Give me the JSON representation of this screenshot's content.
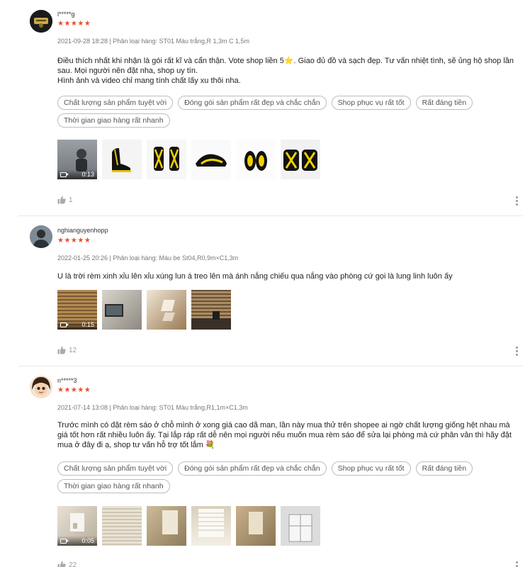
{
  "reviews": [
    {
      "username": "l*****g",
      "rating": 5,
      "stars": "★★★★★",
      "meta": "2021-09-28 18:28 | Phân loại hàng: ST01 Màu trắng,R 1,3m C 1,5m",
      "content": "Điều thích nhất khi nhận là gói rất kĩ và cẩn thận. Vote shop liền 5⭐. Giao đủ đồ và sạch đẹp. Tư vấn nhiệt tình, sẽ ủng hộ shop lần sau. Mọi người nên đặt nha, shop uy tín.\nHình ảnh và video chỉ mang tính chất lấy xu thôi nha.",
      "tags": [
        "Chất lượng sản phẩm tuyệt vời",
        "Đóng gói sản phẩm rất đẹp và chắc chắn",
        "Shop phục vụ rất tốt",
        "Rất đáng tiền",
        "Thời gian giao hàng rất nhanh"
      ],
      "video_duration": "0:13",
      "likes": "1"
    },
    {
      "username": "nghianguyenhopp",
      "rating": 5,
      "stars": "★★★★★",
      "meta": "2022-01-25 20:26 | Phân loại hàng: Màu be St04,R0,9m×C1,3m",
      "content": "U là trời rèm xinh xỉu lên xỉu xúng lun á treo lên mà ánh nắng chiếu qua nắng vào phòng cứ gọi là lung linh luôn ấy",
      "tags": [],
      "video_duration": "0:15",
      "likes": "12"
    },
    {
      "username": "n*****3",
      "rating": 5,
      "stars": "★★★★★",
      "meta": "2021-07-14 13:08 | Phân loại hàng: ST01 Màu trắng,R1,1m×C1,3m",
      "content": "Trước mình có đặt rèm sáo ở chỗ mình ở xong giá cao dã man, lần này mua thử trên shopee ai ngờ chất lượng giống hệt nhau mà giá tốt hơn rất nhiều luôn ấy. Tại lắp ráp rất dễ nên mọi người nếu muốn mua rèm sáo để sửa lại phòng mà cứ phân vân thì hãy đặt mua ở đây đi ạ, shop tư vấn hỗ trợ tốt lắm 💐",
      "tags": [
        "Chất lượng sản phẩm tuyệt vời",
        "Đóng gói sản phẩm rất đẹp và chắc chắn",
        "Shop phục vụ rất tốt",
        "Rất đáng tiền",
        "Thời gian giao hàng rất nhanh"
      ],
      "video_duration": "0:05",
      "likes": "22"
    }
  ],
  "colors": {
    "accent": "#ee4d2d",
    "tag_border": "#bdbdbd",
    "meta": "#8a8a8a"
  },
  "icons": {
    "like": "thumbs-up-icon",
    "more": "more-vertical-icon",
    "video": "video-camera-icon"
  }
}
